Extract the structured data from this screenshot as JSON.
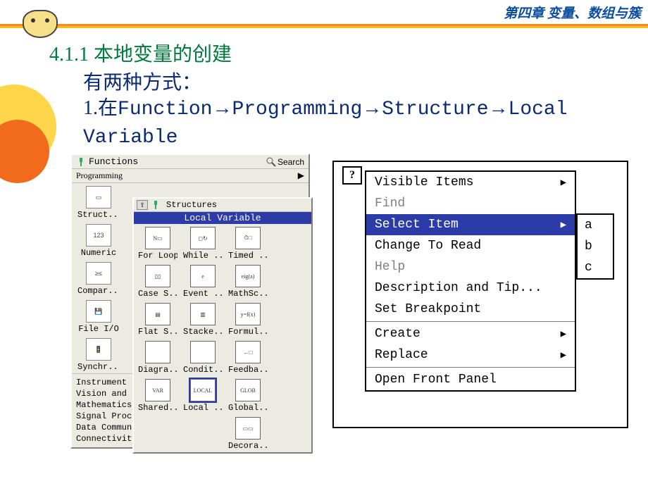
{
  "header": {
    "chapter_banner": "第四章  变量、数组与簇",
    "section_number": "4.1.1",
    "section_title": "本地变量的创建",
    "intro_line": "有两种方式：",
    "path_prefix": "1.在",
    "path_parts": [
      "Function",
      "Programming",
      "Structure",
      "Local Variable"
    ]
  },
  "functions_palette": {
    "title": "Functions",
    "search_label": "Search",
    "subtitle": "Programming",
    "row1": [
      "Struct...",
      "",
      ""
    ],
    "items_left_col": [
      "Struct...",
      "Numeric",
      "Compar...",
      "File I/O",
      "Synchr..."
    ],
    "icons_left": [
      "▭",
      "123",
      "≥≤",
      "💾",
      "🚦"
    ],
    "footer_categories": [
      "Instrument I",
      "Vision and M",
      "Mathematics",
      "Signal Proce",
      "Data Communi",
      "Connectivity"
    ]
  },
  "structures_palette": {
    "title": "Structures",
    "tooltip": "Local Variable",
    "rows": [
      [
        {
          "label": "For Loop",
          "glyph": "N▭"
        },
        {
          "label": "While ...",
          "glyph": "◻↻"
        },
        {
          "label": "Timed ...",
          "glyph": "⏱□"
        }
      ],
      [
        {
          "label": "Case S...",
          "glyph": "▯▯"
        },
        {
          "label": "Event ...",
          "glyph": "e"
        },
        {
          "label": "MathSc...",
          "glyph": "eig(a)"
        }
      ],
      [
        {
          "label": "Flat S...",
          "glyph": "▤"
        },
        {
          "label": "Stacke...",
          "glyph": "▥"
        },
        {
          "label": "Formul...",
          "glyph": "y=f(x)"
        }
      ],
      [
        {
          "label": "Diagra...",
          "glyph": ""
        },
        {
          "label": "Condit...",
          "glyph": ""
        },
        {
          "label": "Feedba...",
          "glyph": "←□"
        }
      ],
      [
        {
          "label": "Shared...",
          "glyph": "VAR"
        },
        {
          "label": "Local ...",
          "glyph": "LOCAL",
          "highlight": true
        },
        {
          "label": "Global...",
          "glyph": "GLOB"
        }
      ],
      [
        {
          "label": "",
          "glyph": ""
        },
        {
          "label": "",
          "glyph": ""
        },
        {
          "label": "Decora...",
          "glyph": "▭▭"
        }
      ]
    ]
  },
  "context_menu": {
    "object_glyph": "?",
    "items": [
      {
        "label": "Visible Items",
        "submenu": true
      },
      {
        "label": "Find",
        "disabled": true
      },
      {
        "label": "Select Item",
        "submenu": true,
        "selected": true
      },
      {
        "label": "Change To Read"
      },
      {
        "label": "Help",
        "disabled": true
      },
      {
        "label": "Description and Tip..."
      },
      {
        "label": "Set Breakpoint"
      },
      {
        "sep": true
      },
      {
        "label": "Create",
        "submenu": true
      },
      {
        "label": "Replace",
        "submenu": true
      },
      {
        "sep": true
      },
      {
        "label": "Open Front Panel"
      }
    ],
    "sub_items": [
      "a",
      "b",
      "c"
    ]
  }
}
